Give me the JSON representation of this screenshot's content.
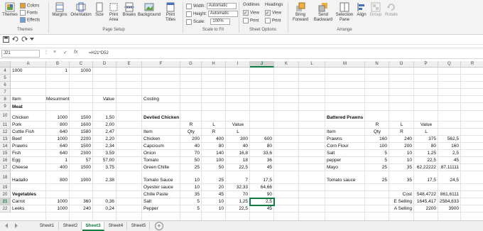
{
  "ribbon": {
    "themes": {
      "label": "Themes",
      "colors": "Colors",
      "fonts": "Fonts",
      "effects": "Effects",
      "group": "Themes"
    },
    "page_setup": {
      "margins": "Margins",
      "orientation": "Orientation",
      "size": "Size",
      "print_area": "Print Area",
      "breaks": "Breaks",
      "background": "Background",
      "print_titles": "Print Titles",
      "group": "Page Setup"
    },
    "scale_to_fit": {
      "width_label": "Width:",
      "width_value": "Automatic",
      "height_label": "Height:",
      "height_value": "Automatic",
      "scale_label": "Scale:",
      "scale_value": "100%",
      "group": "Scale to Fit"
    },
    "sheet_options": {
      "gridlines": "Gridlines",
      "headings": "Headings",
      "view": "View",
      "print": "Print",
      "group": "Sheet Options"
    },
    "arrange": {
      "bring_forward": "Bring Forward",
      "send_backward": "Send Backward",
      "selection_pane": "Selection Pane",
      "align": "Align",
      "group_btn": "Group",
      "rotate": "Rotate",
      "group": "Arrange"
    },
    "colors": {
      "accent": "#107c41"
    }
  },
  "formula_bar": {
    "name_box": "J21",
    "formula": "=H21*D52",
    "cancel": "×",
    "enter": "✓",
    "fx": "fx"
  },
  "columns": [
    "A",
    "B",
    "C",
    "D",
    "E",
    "F",
    "G",
    "H",
    "I",
    "J",
    "K",
    "L",
    "M",
    "N",
    "O",
    "P",
    "Q",
    "R",
    "S"
  ],
  "selected_column": "J",
  "rows": [
    {
      "n": "4",
      "cells": {
        "A": "1000",
        "B": "1",
        "C": "1000"
      }
    },
    {
      "n": "5",
      "cells": {}
    },
    {
      "n": "6",
      "cells": {}
    },
    {
      "n": "7",
      "cells": {}
    },
    {
      "n": "8",
      "cells": {
        "A": "Item",
        "B": "Mesurment",
        "D": "Value",
        "F": "Costing"
      }
    },
    {
      "n": "9",
      "cells": {
        "A": "Meat"
      }
    },
    {
      "n": "10",
      "cells": {
        "A": "Chicken",
        "B": "1000",
        "C": "1500",
        "D": "1,50",
        "F": "Deviled Chicken",
        "M": "Battered Prawns"
      }
    },
    {
      "n": "11",
      "cells": {
        "A": "Pork",
        "B": "800",
        "C": "1600",
        "D": "2,00",
        "G": "R",
        "H": "L",
        "I": "Value",
        "N": "R",
        "O": "L",
        "P": "Value"
      }
    },
    {
      "n": "12",
      "cells": {
        "A": "Cuttle Fish",
        "B": "640",
        "C": "1580",
        "D": "2,47",
        "F": "Item",
        "G": "Qty",
        "H": "R",
        "I": "L",
        "M": "Item",
        "N": "Qty",
        "O": "R",
        "P": "L"
      }
    },
    {
      "n": "13",
      "cells": {
        "A": "Beef",
        "B": "1000",
        "C": "2200",
        "D": "2,20",
        "F": "Chicken",
        "G": "200",
        "H": "400",
        "I": "300",
        "J": "600",
        "M": "Prawns",
        "N": "160",
        "O": "240",
        "P": "375",
        "Q": "562,5"
      }
    },
    {
      "n": "14",
      "cells": {
        "A": "Prawns",
        "B": "640",
        "C": "1500",
        "D": "2,34",
        "F": "Capcicum",
        "G": "40",
        "H": "80",
        "I": "40",
        "J": "80",
        "M": "Corn Flour",
        "N": "100",
        "O": "200",
        "P": "80",
        "Q": "160"
      }
    },
    {
      "n": "15",
      "cells": {
        "A": "Fish",
        "B": "640",
        "C": "2300",
        "D": "3,59",
        "F": "Onion",
        "G": "70",
        "H": "140",
        "I": "16,8",
        "J": "33,6",
        "M": "Salt",
        "N": "5",
        "O": "10",
        "P": "1,25",
        "Q": "2,5"
      }
    },
    {
      "n": "16",
      "cells": {
        "A": "Egg",
        "B": "1",
        "C": "57",
        "D": "57,00",
        "F": "Tomato",
        "G": "50",
        "H": "100",
        "I": "18",
        "J": "36",
        "M": "pepper",
        "N": "5",
        "O": "10",
        "P": "22,5",
        "Q": "45"
      }
    },
    {
      "n": "17",
      "cells": {
        "A": "Cheese",
        "B": "400",
        "C": "1500",
        "D": "3,75",
        "F": "Green Chille",
        "G": "25",
        "H": "50",
        "I": "22,5",
        "J": "45",
        "M": "Mayo",
        "N": "25",
        "O": "35",
        "P": "62,22222",
        "Q": "87,11111"
      }
    },
    {
      "n": "18",
      "cells": {
        "A": "Hadallo",
        "B": "800",
        "C": "1900",
        "D": "2,38",
        "F": "Tomato Sauce",
        "G": "10",
        "H": "25",
        "I": "7",
        "J": "17,5",
        "M": "Tomato sauce",
        "N": "25",
        "O": "35",
        "P": "17,5",
        "Q": "24,5"
      }
    },
    {
      "n": "19",
      "cells": {
        "F": "Oyester sauce",
        "G": "10",
        "H": "20",
        "I": "32,33",
        "J": "64,66"
      }
    },
    {
      "n": "20",
      "cells": {
        "A": "Vegetables",
        "F": "Chille Paste",
        "G": "35",
        "H": "45",
        "I": "70",
        "J": "90",
        "O": "Cost",
        "P": "548,4722",
        "Q": "861,6111"
      }
    },
    {
      "n": "21",
      "cells": {
        "A": "Carrot",
        "B": "1000",
        "C": "360",
        "D": "0,36",
        "F": "Salt",
        "G": "5",
        "H": "10",
        "I": "1,25",
        "J": "2,5",
        "O": "E Selling",
        "P": "1645,417",
        "Q": "2584,833"
      }
    },
    {
      "n": "22",
      "cells": {
        "A": "Leeks",
        "B": "1000",
        "C": "240",
        "D": "0,24",
        "F": "Pepper",
        "G": "5",
        "H": "10",
        "I": "22,5",
        "J": "45",
        "O": "A Selling",
        "P": "2200",
        "Q": "3900"
      }
    }
  ],
  "sheets": [
    "Sheet1",
    "Sheet2",
    "Sheet3",
    "Sheet4",
    "Sheet5"
  ],
  "active_sheet": "Sheet3",
  "add_sheet": "+"
}
